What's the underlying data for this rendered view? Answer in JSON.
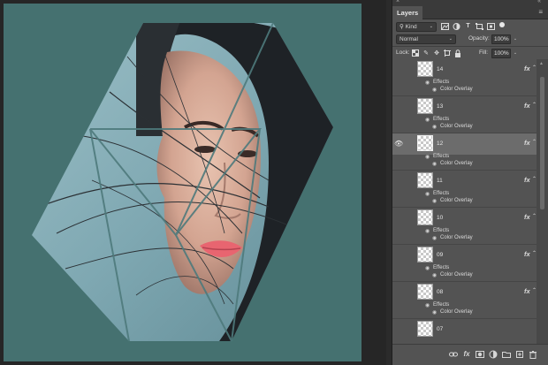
{
  "panel": {
    "close_glyph": "×",
    "collapse_glyph": "«",
    "tab_label": "Layers",
    "menu_glyph": "≡"
  },
  "filter": {
    "kind_label": "Kind",
    "kind_prefix": "⚲",
    "caret": "⌄"
  },
  "blend": {
    "mode": "Normal",
    "opacity_label": "Opacity:",
    "opacity_value": "100%",
    "fill_label": "Fill:",
    "fill_value": "100%",
    "lock_label": "Lock:"
  },
  "layers": [
    {
      "name": "14",
      "effects_label": "Effects",
      "effect": "Color Overlay",
      "visible": false,
      "selected": false
    },
    {
      "name": "13",
      "effects_label": "Effects",
      "effect": "Color Overlay",
      "visible": false,
      "selected": false
    },
    {
      "name": "12",
      "effects_label": "Effects",
      "effect": "Color Overlay",
      "visible": true,
      "selected": true
    },
    {
      "name": "11",
      "effects_label": "Effects",
      "effect": "Color Overlay",
      "visible": false,
      "selected": false
    },
    {
      "name": "10",
      "effects_label": "Effects",
      "effect": "Color Overlay",
      "visible": false,
      "selected": false
    },
    {
      "name": "09",
      "effects_label": "Effects",
      "effect": "Color Overlay",
      "visible": false,
      "selected": false
    },
    {
      "name": "08",
      "effects_label": "Effects",
      "effect": "Color Overlay",
      "visible": false,
      "selected": false
    },
    {
      "name": "07",
      "effects_label": "",
      "effect": "",
      "visible": false,
      "selected": false
    }
  ],
  "fx_label": "fx",
  "colors": {
    "canvas_bg": "#457170",
    "panel_bg": "#535353",
    "selected_row": "#6c6c6c"
  }
}
